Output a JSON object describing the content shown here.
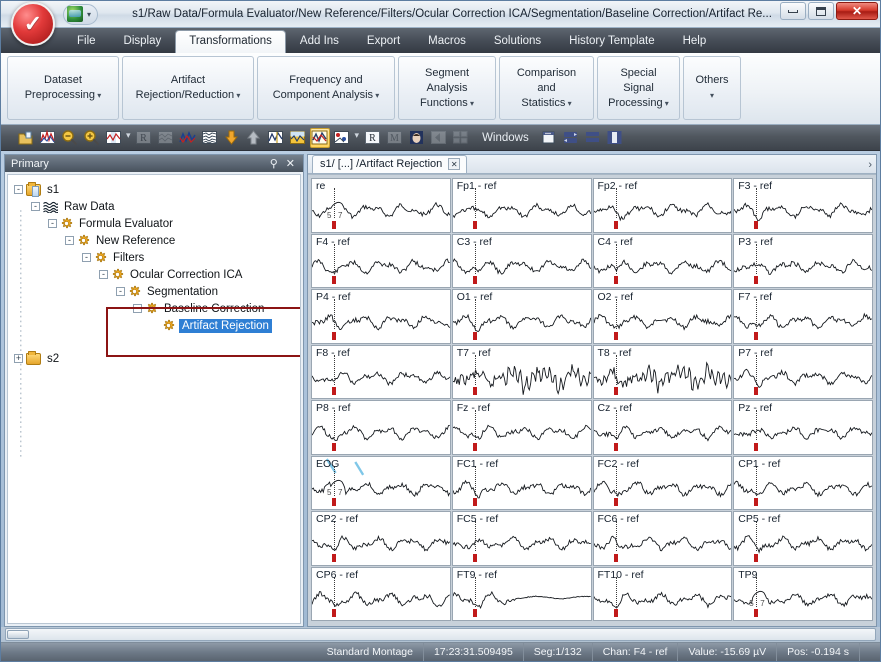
{
  "window": {
    "title": "s1/Raw Data/Formula Evaluator/New Reference/Filters/Ocular Correction ICA/Segmentation/Baseline Correction/Artifact Re...",
    "qat_dropdown": "▾",
    "minimize_label": "minimize",
    "maximize_label": "maximize",
    "close_label": "✕"
  },
  "menu": {
    "tabs": [
      {
        "label": "File",
        "active": false
      },
      {
        "label": "Display",
        "active": false
      },
      {
        "label": "Transformations",
        "active": true
      },
      {
        "label": "Add Ins",
        "active": false
      },
      {
        "label": "Export",
        "active": false
      },
      {
        "label": "Macros",
        "active": false
      },
      {
        "label": "Solutions",
        "active": false
      },
      {
        "label": "History Template",
        "active": false
      },
      {
        "label": "Help",
        "active": false
      }
    ]
  },
  "ribbon": {
    "groups": [
      {
        "line1": "Dataset",
        "line2": "Preprocessing",
        "caret": "▾",
        "width": 112
      },
      {
        "line1": "Artifact",
        "line2": "Rejection/Reduction",
        "caret": "▾",
        "width": 132
      },
      {
        "line1": "Frequency and",
        "line2": "Component Analysis",
        "caret": "▾",
        "width": 138
      },
      {
        "line1": "Segment Analysis",
        "line2": "Functions",
        "caret": "▾",
        "width": 98
      },
      {
        "line1": "Comparison and",
        "line2": "Statistics",
        "caret": "▾",
        "width": 95
      },
      {
        "line1": "Special Signal",
        "line2": "Processing",
        "caret": "▾",
        "width": 83
      },
      {
        "line1": "Others",
        "line2": "",
        "caret": "▾",
        "width": 50
      }
    ]
  },
  "toolbar": {
    "windows_label": "Windows",
    "buttons": [
      {
        "name": "open-file-icon",
        "type": "folder",
        "enabled": true,
        "selected": false
      },
      {
        "name": "edit-markers-icon",
        "type": "peaks",
        "enabled": true,
        "selected": false
      },
      {
        "name": "zoom-out-icon",
        "type": "magnifier-minus",
        "enabled": true,
        "selected": false
      },
      {
        "name": "zoom-in-icon",
        "type": "magnifier-plus",
        "enabled": true,
        "selected": false
      },
      {
        "name": "channel-display-icon",
        "type": "grid-red",
        "enabled": true,
        "selected": false
      },
      {
        "name": "toolbar-separator",
        "type": "sep",
        "enabled": true,
        "selected": false
      },
      {
        "name": "raw-view-icon",
        "type": "letter-R",
        "enabled": false,
        "selected": false
      },
      {
        "name": "segments-view-icon",
        "type": "letter-seg",
        "enabled": false,
        "selected": false
      },
      {
        "name": "overlay-waveform-icon",
        "type": "peaks2",
        "enabled": true,
        "selected": false
      },
      {
        "name": "stacked-waveform-icon",
        "type": "stack",
        "enabled": true,
        "selected": false
      },
      {
        "name": "scale-down-icon",
        "type": "arrow-down",
        "enabled": true,
        "selected": false
      },
      {
        "name": "scale-up-icon",
        "type": "arrow-up",
        "enabled": true,
        "selected": false
      },
      {
        "name": "butterfly-plot-icon",
        "type": "butterfly",
        "enabled": true,
        "selected": false
      },
      {
        "name": "topography-icon",
        "type": "topo",
        "enabled": true,
        "selected": false
      },
      {
        "name": "multi-channel-view-icon",
        "type": "multiview",
        "enabled": true,
        "selected": true
      },
      {
        "name": "map-view-icon",
        "type": "mapview",
        "enabled": true,
        "selected": false
      },
      {
        "name": "toolbar-separator-2",
        "type": "sep",
        "enabled": true,
        "selected": false
      },
      {
        "name": "raw-data-icon",
        "type": "letter-R2",
        "enabled": true,
        "selected": false
      },
      {
        "name": "montage-icon",
        "type": "letter-M",
        "enabled": false,
        "selected": false
      },
      {
        "name": "head-model-icon",
        "type": "head",
        "enabled": true,
        "selected": false
      },
      {
        "name": "back-icon",
        "type": "back",
        "enabled": false,
        "selected": false
      },
      {
        "name": "tile-icon",
        "type": "tile",
        "enabled": false,
        "selected": false
      }
    ],
    "window_buttons": [
      {
        "name": "cascade-windows-icon",
        "type": "cascade"
      },
      {
        "name": "tile-windows-icon",
        "type": "tilewin"
      },
      {
        "name": "tile-horizontal-icon",
        "type": "tileh"
      },
      {
        "name": "tile-vertical-icon",
        "type": "tilev"
      }
    ]
  },
  "sidebar": {
    "title": "Primary",
    "pin_icon": "⚲",
    "close_icon": "✕",
    "tree": [
      {
        "label": "s1",
        "depth": 0,
        "expander": "-",
        "icon": "folder-doc",
        "selected": false
      },
      {
        "label": "Raw Data",
        "depth": 1,
        "expander": "-",
        "icon": "waveform",
        "selected": false
      },
      {
        "label": "Formula Evaluator",
        "depth": 2,
        "expander": "-",
        "icon": "gear",
        "selected": false
      },
      {
        "label": "New Reference",
        "depth": 3,
        "expander": "-",
        "icon": "gear",
        "selected": false
      },
      {
        "label": "Filters",
        "depth": 4,
        "expander": "-",
        "icon": "gear",
        "selected": false
      },
      {
        "label": "Ocular Correction ICA",
        "depth": 5,
        "expander": "-",
        "icon": "gear",
        "selected": false
      },
      {
        "label": "Segmentation",
        "depth": 6,
        "expander": "-",
        "icon": "gear",
        "selected": false
      },
      {
        "label": "Baseline Correction",
        "depth": 7,
        "expander": "-",
        "icon": "gear",
        "selected": false
      },
      {
        "label": "Artifact Rejection",
        "depth": 8,
        "expander": "",
        "icon": "gear",
        "selected": true
      },
      {
        "label": "s2",
        "depth": 0,
        "expander": "+",
        "icon": "folder",
        "selected": false
      }
    ],
    "highlight_color": "#8c1414"
  },
  "view": {
    "tab_label": "s1/ [...] /Artifact Rejection",
    "tab_close": "✕",
    "more_arrow": "›",
    "channels": [
      {
        "label": "re",
        "seg_label": "5",
        "seg_label2": "7"
      },
      {
        "label": "Fp1 - ref",
        "seg_label": "",
        "seg_label2": ""
      },
      {
        "label": "Fp2 - ref",
        "seg_label": "",
        "seg_label2": ""
      },
      {
        "label": "F3 - ref",
        "seg_label": "",
        "seg_label2": ""
      },
      {
        "label": "F4 - ref",
        "seg_label": "",
        "seg_label2": ""
      },
      {
        "label": "C3 - ref",
        "seg_label": "",
        "seg_label2": ""
      },
      {
        "label": "C4 - ref",
        "seg_label": "",
        "seg_label2": ""
      },
      {
        "label": "P3 - ref",
        "seg_label": "",
        "seg_label2": ""
      },
      {
        "label": "P4 - ref",
        "seg_label": "",
        "seg_label2": ""
      },
      {
        "label": "O1 - ref",
        "seg_label": "",
        "seg_label2": ""
      },
      {
        "label": "O2 - ref",
        "seg_label": "",
        "seg_label2": ""
      },
      {
        "label": "F7 - ref",
        "seg_label": "",
        "seg_label2": ""
      },
      {
        "label": "F8 - ref",
        "seg_label": "",
        "seg_label2": ""
      },
      {
        "label": "T7 - ref",
        "seg_label": "",
        "seg_label2": ""
      },
      {
        "label": "T8 - ref",
        "seg_label": "",
        "seg_label2": ""
      },
      {
        "label": "P7 - ref",
        "seg_label": "",
        "seg_label2": ""
      },
      {
        "label": "P8 - ref",
        "seg_label": "",
        "seg_label2": ""
      },
      {
        "label": "Fz - ref",
        "seg_label": "",
        "seg_label2": ""
      },
      {
        "label": "Cz - ref",
        "seg_label": "",
        "seg_label2": ""
      },
      {
        "label": "Pz - ref",
        "seg_label": "",
        "seg_label2": ""
      },
      {
        "label": "EOG",
        "seg_label": "5",
        "seg_label2": "7"
      },
      {
        "label": "FC1 - ref",
        "seg_label": "",
        "seg_label2": ""
      },
      {
        "label": "FC2 - ref",
        "seg_label": "",
        "seg_label2": ""
      },
      {
        "label": "CP1 - ref",
        "seg_label": "",
        "seg_label2": ""
      },
      {
        "label": "CP2 - ref",
        "seg_label": "",
        "seg_label2": ""
      },
      {
        "label": "FC5 - ref",
        "seg_label": "",
        "seg_label2": ""
      },
      {
        "label": "FC6 - ref",
        "seg_label": "",
        "seg_label2": ""
      },
      {
        "label": "CP5 - ref",
        "seg_label": "",
        "seg_label2": ""
      },
      {
        "label": "CP6 - ref",
        "seg_label": "",
        "seg_label2": ""
      },
      {
        "label": "FT9 - ref",
        "seg_label": "",
        "seg_label2": ""
      },
      {
        "label": "FT10 - ref",
        "seg_label": "",
        "seg_label2": ""
      },
      {
        "label": "TP9",
        "seg_label": "5",
        "seg_label2": "7"
      }
    ]
  },
  "status": {
    "montage": "Standard Montage",
    "time": "17:23:31.509495",
    "segment": "Seg:1/132",
    "channel": "Chan:  F4 - ref",
    "value": "Value: -15.69 µV",
    "position": "Pos:  -0.194 s"
  }
}
